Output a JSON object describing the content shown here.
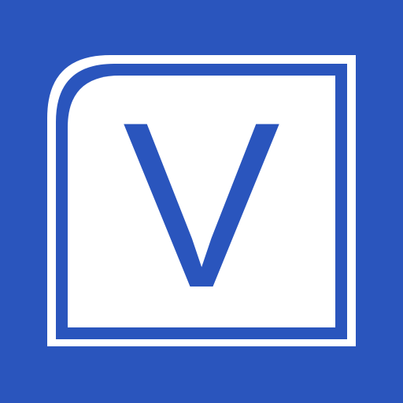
{
  "icon": {
    "name": "visio-app-icon",
    "letter": "V",
    "colors": {
      "background": "#2a55bd",
      "tile": "#ffffff",
      "accent": "#2a55bd"
    }
  }
}
